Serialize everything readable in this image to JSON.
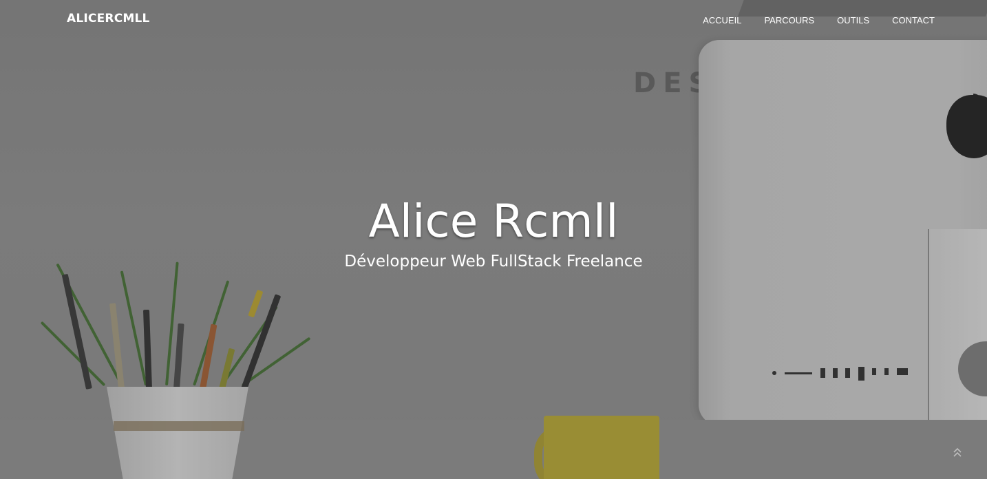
{
  "brand": {
    "name": "ALICERCMLL"
  },
  "nav": {
    "items": [
      {
        "label": "ACCUEIL"
      },
      {
        "label": "PARCOURS"
      },
      {
        "label": "OUTILS"
      },
      {
        "label": "CONTACT"
      }
    ]
  },
  "hero": {
    "title": "Alice Rcmll",
    "subtitle": "Développeur Web FullStack Freelance",
    "background_wall_text": "DES"
  },
  "icons": {
    "scroll_top": "double-chevron-up-icon"
  },
  "colors": {
    "text": "#ffffff",
    "overlay": "#5a5a5a",
    "mug": "#b5a42e",
    "plant": "#3f6b2e"
  }
}
